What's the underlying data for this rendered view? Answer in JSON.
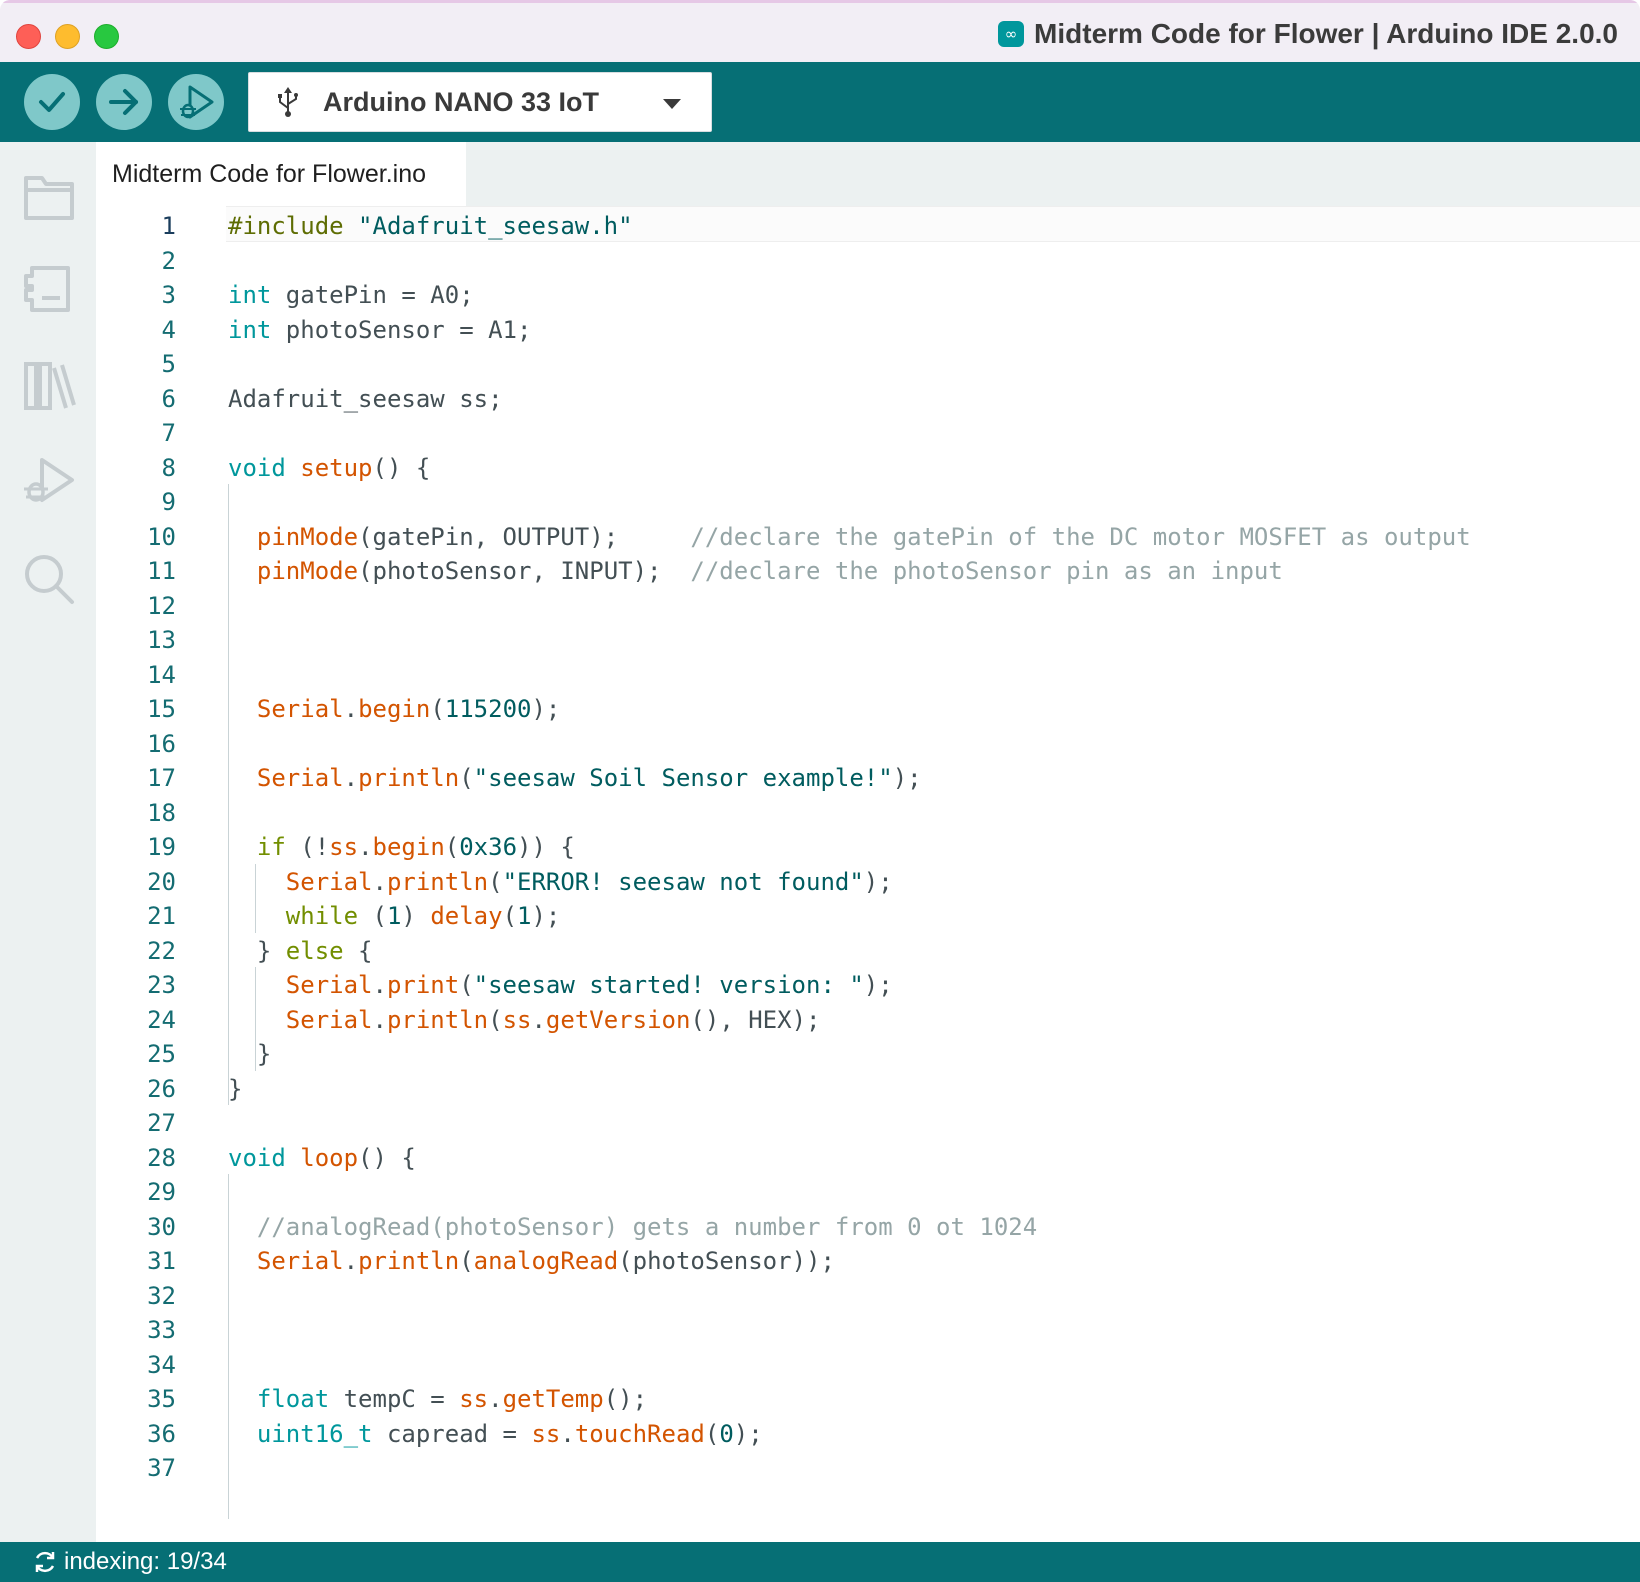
{
  "window": {
    "title": "Midterm Code for Flower | Arduino IDE 2.0.0"
  },
  "toolbar": {
    "verify_icon": "check-icon",
    "upload_icon": "arrow-right-icon",
    "debug_icon": "debug-icon",
    "board": "Arduino NANO 33 IoT"
  },
  "sidebar": {
    "items": [
      "folder-icon",
      "board-manager-icon",
      "library-icon",
      "debug-icon",
      "search-icon"
    ]
  },
  "editor": {
    "tab": "Midterm Code for Flower.ino",
    "active_line": 1,
    "lines": [
      [
        [
          "pp",
          "#include "
        ],
        [
          "str",
          "\"Adafruit_seesaw.h\""
        ]
      ],
      [],
      [
        [
          "kw",
          "int"
        ],
        [
          "id",
          " gatePin = A0;"
        ]
      ],
      [
        [
          "kw",
          "int"
        ],
        [
          "id",
          " photoSensor = A1;"
        ]
      ],
      [],
      [
        [
          "id",
          "Adafruit_seesaw ss;"
        ]
      ],
      [],
      [
        [
          "kw",
          "void"
        ],
        [
          "id",
          " "
        ],
        [
          "fn",
          "setup"
        ],
        [
          "id",
          "() {"
        ]
      ],
      [],
      [
        [
          "id",
          "  "
        ],
        [
          "fn",
          "pinMode"
        ],
        [
          "id",
          "(gatePin, OUTPUT);     "
        ],
        [
          "cmt",
          "//declare the gatePin of the DC motor MOSFET as output"
        ]
      ],
      [
        [
          "id",
          "  "
        ],
        [
          "fn",
          "pinMode"
        ],
        [
          "id",
          "(photoSensor, INPUT);  "
        ],
        [
          "cmt",
          "//declare the photoSensor pin as an input"
        ]
      ],
      [],
      [],
      [],
      [
        [
          "id",
          "  "
        ],
        [
          "fn",
          "Serial"
        ],
        [
          "id",
          "."
        ],
        [
          "fn",
          "begin"
        ],
        [
          "id",
          "("
        ],
        [
          "str",
          "115200"
        ],
        [
          "id",
          ");"
        ]
      ],
      [],
      [
        [
          "id",
          "  "
        ],
        [
          "fn",
          "Serial"
        ],
        [
          "id",
          "."
        ],
        [
          "fn",
          "println"
        ],
        [
          "id",
          "("
        ],
        [
          "str",
          "\"seesaw Soil Sensor example!\""
        ],
        [
          "id",
          ");"
        ]
      ],
      [],
      [
        [
          "id",
          "  "
        ],
        [
          "ctrl",
          "if"
        ],
        [
          "id",
          " (!"
        ],
        [
          "fn",
          "ss"
        ],
        [
          "id",
          "."
        ],
        [
          "fn",
          "begin"
        ],
        [
          "id",
          "("
        ],
        [
          "str",
          "0x36"
        ],
        [
          "id",
          ")) {"
        ]
      ],
      [
        [
          "id",
          "    "
        ],
        [
          "fn",
          "Serial"
        ],
        [
          "id",
          "."
        ],
        [
          "fn",
          "println"
        ],
        [
          "id",
          "("
        ],
        [
          "str",
          "\"ERROR! seesaw not found\""
        ],
        [
          "id",
          ");"
        ]
      ],
      [
        [
          "id",
          "    "
        ],
        [
          "ctrl",
          "while"
        ],
        [
          "id",
          " ("
        ],
        [
          "str",
          "1"
        ],
        [
          "id",
          ") "
        ],
        [
          "fn",
          "delay"
        ],
        [
          "id",
          "("
        ],
        [
          "str",
          "1"
        ],
        [
          "id",
          ");"
        ]
      ],
      [
        [
          "id",
          "  } "
        ],
        [
          "ctrl",
          "else"
        ],
        [
          "id",
          " {"
        ]
      ],
      [
        [
          "id",
          "    "
        ],
        [
          "fn",
          "Serial"
        ],
        [
          "id",
          "."
        ],
        [
          "fn",
          "print"
        ],
        [
          "id",
          "("
        ],
        [
          "str",
          "\"seesaw started! version: \""
        ],
        [
          "id",
          ");"
        ]
      ],
      [
        [
          "id",
          "    "
        ],
        [
          "fn",
          "Serial"
        ],
        [
          "id",
          "."
        ],
        [
          "fn",
          "println"
        ],
        [
          "id",
          "("
        ],
        [
          "fn",
          "ss"
        ],
        [
          "id",
          "."
        ],
        [
          "fn",
          "getVersion"
        ],
        [
          "id",
          "(), HEX);"
        ]
      ],
      [
        [
          "id",
          "  }"
        ]
      ],
      [
        [
          "id",
          "}"
        ]
      ],
      [],
      [
        [
          "kw",
          "void"
        ],
        [
          "id",
          " "
        ],
        [
          "fn",
          "loop"
        ],
        [
          "id",
          "() {"
        ]
      ],
      [],
      [
        [
          "id",
          "  "
        ],
        [
          "cmt",
          "//analogRead(photoSensor) gets a number from 0 ot 1024"
        ]
      ],
      [
        [
          "id",
          "  "
        ],
        [
          "fn",
          "Serial"
        ],
        [
          "id",
          "."
        ],
        [
          "fn",
          "println"
        ],
        [
          "id",
          "("
        ],
        [
          "fn",
          "analogRead"
        ],
        [
          "id",
          "(photoSensor));"
        ]
      ],
      [],
      [],
      [],
      [
        [
          "id",
          "  "
        ],
        [
          "kw",
          "float"
        ],
        [
          "id",
          " tempC = "
        ],
        [
          "fn",
          "ss"
        ],
        [
          "id",
          "."
        ],
        [
          "fn",
          "getTemp"
        ],
        [
          "id",
          "();"
        ]
      ],
      [
        [
          "id",
          "  "
        ],
        [
          "kw",
          "uint16_t"
        ],
        [
          "id",
          " capread = "
        ],
        [
          "fn",
          "ss"
        ],
        [
          "id",
          "."
        ],
        [
          "fn",
          "touchRead"
        ],
        [
          "id",
          "("
        ],
        [
          "str",
          "0"
        ],
        [
          "id",
          ");"
        ]
      ],
      []
    ]
  },
  "status": {
    "icon": "sync-icon",
    "text": "indexing: 19/34"
  },
  "colors": {
    "toolbar_bg": "#066f75",
    "button_bg": "#7fc8c9",
    "keyword": "#00979c",
    "function": "#d35400",
    "string": "#005c5f",
    "preprocessor": "#5e6d03",
    "control": "#728e00",
    "comment": "#95a5a6"
  }
}
